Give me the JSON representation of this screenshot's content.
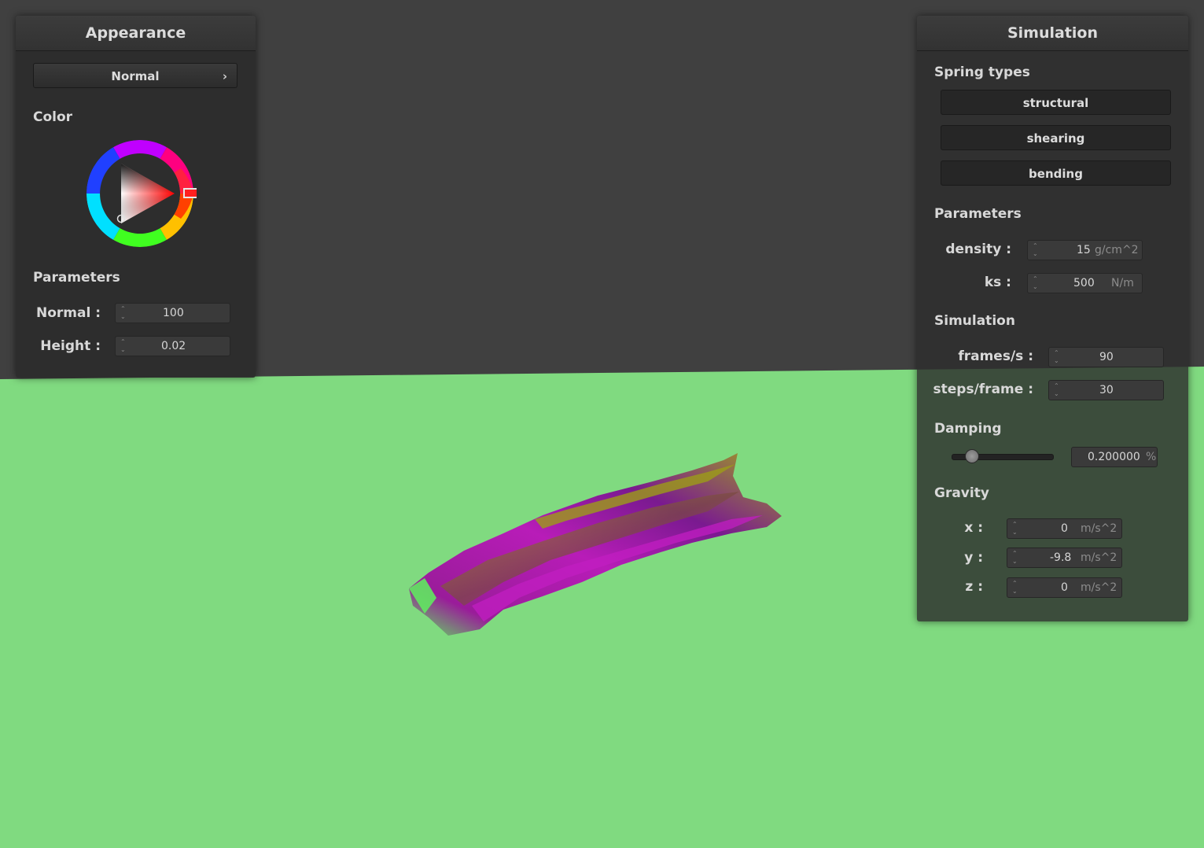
{
  "appearance": {
    "title": "Appearance",
    "shader_dropdown": "Normal",
    "color_section": "Color",
    "params_section": "Parameters",
    "normal_label": "Normal :",
    "normal_value": "100",
    "height_label": "Height :",
    "height_value": "0.02",
    "color_hex": "#ff0000"
  },
  "simulation": {
    "title": "Simulation",
    "spring_types_section": "Spring types",
    "spring_buttons": [
      "structural",
      "shearing",
      "bending"
    ],
    "params_section": "Parameters",
    "density_label": "density :",
    "density_value": "15",
    "density_unit": "g/cm^2",
    "ks_label": "ks :",
    "ks_value": "500",
    "ks_unit": "N/m",
    "sim_section": "Simulation",
    "fps_label": "frames/s :",
    "fps_value": "90",
    "steps_label": "steps/frame :",
    "steps_value": "30",
    "damping_section": "Damping",
    "damping_value": "0.200000",
    "damping_unit": "%",
    "damping_fraction": 0.2,
    "gravity_section": "Gravity",
    "gx_label": "x :",
    "gx_value": "0",
    "gy_label": "y :",
    "gy_value": "-9.8",
    "gz_label": "z :",
    "gz_value": "0",
    "gravity_unit": "m/s^2"
  },
  "colors": {
    "floor": "#80da80",
    "background": "#404040",
    "cloth_primary": "#a01aa0",
    "cloth_secondary": "#8a8a10",
    "cloth_edge": "#50e050"
  }
}
